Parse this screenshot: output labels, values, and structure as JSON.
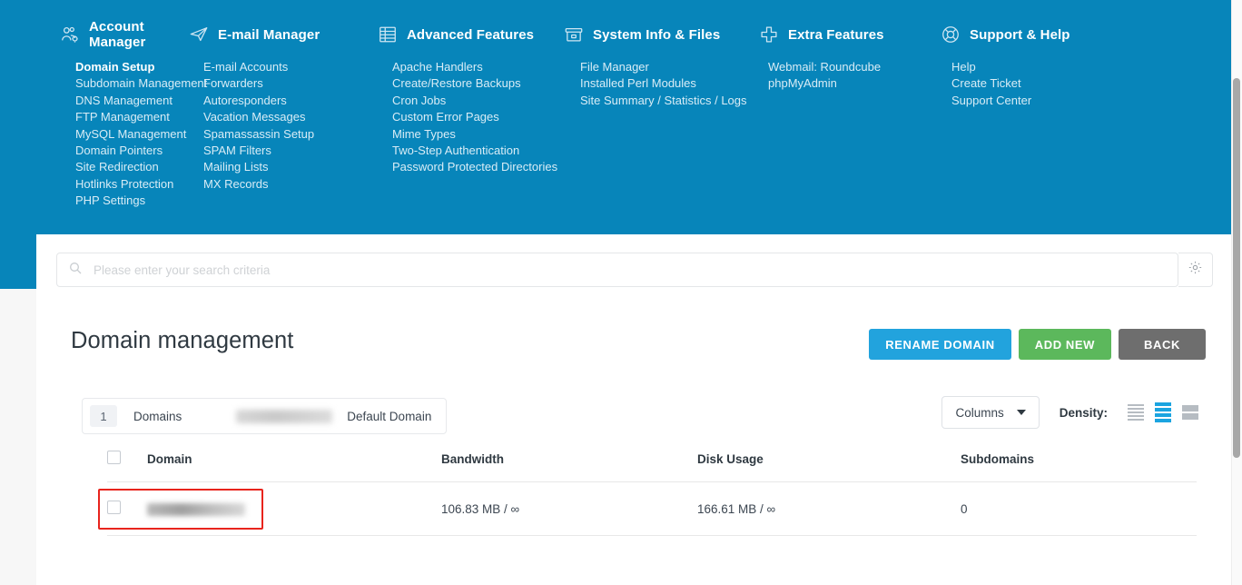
{
  "nav": {
    "columns": [
      {
        "icon": "users-gear-icon",
        "title": "Account Manager",
        "items": [
          {
            "label": "Domain Setup",
            "current": true
          },
          {
            "label": "Subdomain Management",
            "current": false
          },
          {
            "label": "DNS Management",
            "current": false
          },
          {
            "label": "FTP Management",
            "current": false
          },
          {
            "label": "MySQL Management",
            "current": false
          },
          {
            "label": "Domain Pointers",
            "current": false
          },
          {
            "label": "Site Redirection",
            "current": false
          },
          {
            "label": "Hotlinks Protection",
            "current": false
          },
          {
            "label": "PHP Settings",
            "current": false
          }
        ]
      },
      {
        "icon": "paper-plane-icon",
        "title": "E-mail Manager",
        "items": [
          {
            "label": "E-mail Accounts",
            "current": false
          },
          {
            "label": "Forwarders",
            "current": false
          },
          {
            "label": "Autoresponders",
            "current": false
          },
          {
            "label": "Vacation Messages",
            "current": false
          },
          {
            "label": "Spamassassin Setup",
            "current": false
          },
          {
            "label": "SPAM Filters",
            "current": false
          },
          {
            "label": "Mailing Lists",
            "current": false
          },
          {
            "label": "MX Records",
            "current": false
          }
        ]
      },
      {
        "icon": "table-list-icon",
        "title": "Advanced Features",
        "items": [
          {
            "label": "Apache Handlers",
            "current": false
          },
          {
            "label": "Create/Restore Backups",
            "current": false
          },
          {
            "label": "Cron Jobs",
            "current": false
          },
          {
            "label": "Custom Error Pages",
            "current": false
          },
          {
            "label": "Mime Types",
            "current": false
          },
          {
            "label": "Two-Step Authentication",
            "current": false
          },
          {
            "label": "Password Protected Directories",
            "current": false
          }
        ]
      },
      {
        "icon": "archive-box-icon",
        "title": "System Info & Files",
        "items": [
          {
            "label": "File Manager",
            "current": false
          },
          {
            "label": "Installed Perl Modules",
            "current": false
          },
          {
            "label": "Site Summary / Statistics / Logs",
            "current": false
          }
        ]
      },
      {
        "icon": "plus-cross-icon",
        "title": "Extra Features",
        "items": [
          {
            "label": "Webmail: Roundcube",
            "current": false
          },
          {
            "label": "phpMyAdmin",
            "current": false
          }
        ]
      },
      {
        "icon": "life-ring-icon",
        "title": "Support & Help",
        "items": [
          {
            "label": "Help",
            "current": false
          },
          {
            "label": "Create Ticket",
            "current": false
          },
          {
            "label": "Support Center",
            "current": false
          }
        ]
      }
    ]
  },
  "search": {
    "placeholder": "Please enter your search criteria",
    "value": "",
    "icon": "search-icon",
    "settings_icon": "gear-icon"
  },
  "page": {
    "title": "Domain management"
  },
  "actions": {
    "rename": "RENAME DOMAIN",
    "add_new": "ADD NEW",
    "back": "BACK"
  },
  "summary": {
    "count": "1",
    "count_label": "Domains",
    "domain_name": "",
    "default_label": "Default Domain"
  },
  "tools": {
    "columns_label": "Columns",
    "density_label": "Density:",
    "density_options": [
      "compact",
      "standard",
      "comfortable"
    ],
    "density_selected": "standard"
  },
  "table": {
    "headers": [
      "Domain",
      "Bandwidth",
      "Disk Usage",
      "Subdomains"
    ],
    "rows": [
      {
        "domain": "",
        "bandwidth": "106.83 MB / ∞",
        "disk_usage": "166.61 MB / ∞",
        "subdomains": "0"
      }
    ]
  },
  "colors": {
    "nav_blue": "#0785ba",
    "rename_blue": "#22a3dd",
    "add_green": "#5cb85c",
    "back_gray": "#6e6e6e",
    "density_active": "#1ba4e0",
    "annotation_red": "#e8241d"
  }
}
